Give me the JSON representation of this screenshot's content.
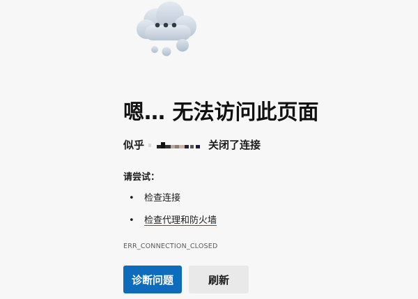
{
  "error_page": {
    "title": "嗯… 无法访问此页面",
    "subtitle_prefix": "似乎",
    "subtitle_suffix": "关闭了连接",
    "try_label": "请尝试：",
    "suggestions": [
      {
        "label": "检查连接",
        "link": false
      },
      {
        "label": "检查代理和防火墙",
        "link": true
      }
    ],
    "error_code": "ERR_CONNECTION_CLOSED",
    "buttons": {
      "diagnose": "诊断问题",
      "refresh": "刷新"
    }
  },
  "colors": {
    "primary": "#0f6cbd",
    "secondary_bg": "#e9e9e9",
    "background": "#f7f7f7",
    "link_underline": "#0067b8"
  },
  "icons": {
    "cloud": "cloud-error-icon"
  }
}
